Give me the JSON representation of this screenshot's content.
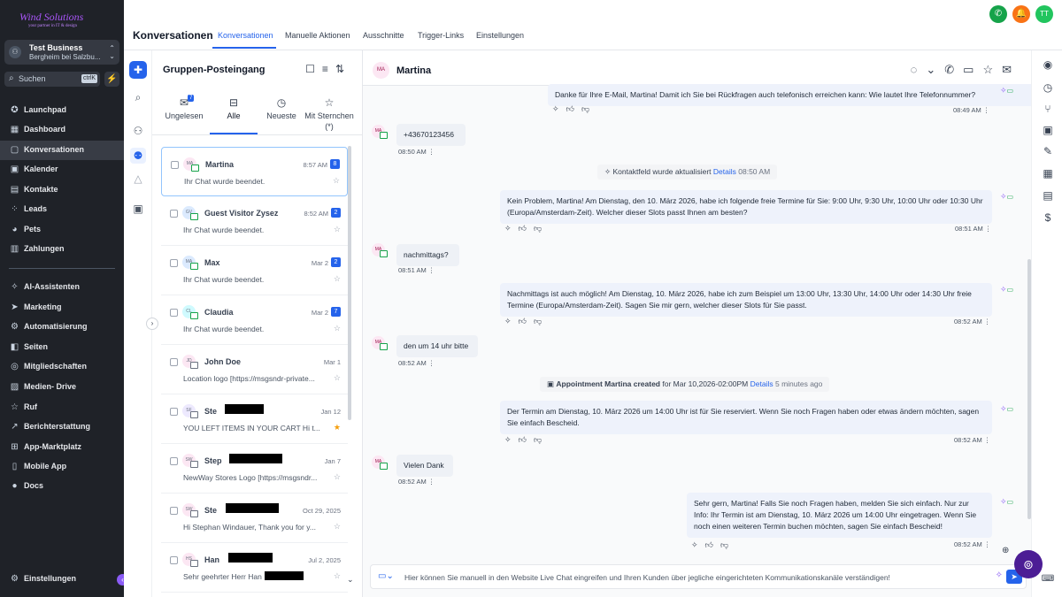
{
  "brand": {
    "logo_text": "Wind Solutions",
    "logo_sub": "your partner in IT & design",
    "color": "#a855f7"
  },
  "account": {
    "initial": "⚇",
    "name": "Test Business",
    "location": "Bergheim bei Salzbu..."
  },
  "search": {
    "placeholder": "Suchen",
    "shortcut": "ctrlK"
  },
  "nav": {
    "items": [
      {
        "label": "Launchpad",
        "icon": "rocket-icon",
        "glyph": "✪"
      },
      {
        "label": "Dashboard",
        "icon": "dashboard-icon",
        "glyph": "▦"
      },
      {
        "label": "Konversationen",
        "icon": "chat-icon",
        "glyph": "▢"
      },
      {
        "label": "Kalender",
        "icon": "calendar-icon",
        "glyph": "▣"
      },
      {
        "label": "Kontakte",
        "icon": "contacts-icon",
        "glyph": "▤"
      },
      {
        "label": "Leads",
        "icon": "leads-icon",
        "glyph": "⁘"
      },
      {
        "label": "Pets",
        "icon": "pets-icon",
        "glyph": "◕"
      },
      {
        "label": "Zahlungen",
        "icon": "payments-icon",
        "glyph": "▥"
      },
      {
        "label": "AI-Assistenten",
        "icon": "ai-icon",
        "glyph": "✧"
      },
      {
        "label": "Marketing",
        "icon": "marketing-icon",
        "glyph": "➤"
      },
      {
        "label": "Automatisierung",
        "icon": "automation-icon",
        "glyph": "⚙"
      },
      {
        "label": "Seiten",
        "icon": "pages-icon",
        "glyph": "◧"
      },
      {
        "label": "Mitgliedschaften",
        "icon": "membership-icon",
        "glyph": "◎"
      },
      {
        "label": "Medien- Drive",
        "icon": "media-icon",
        "glyph": "▨"
      },
      {
        "label": "Ruf",
        "icon": "star-icon",
        "glyph": "☆"
      },
      {
        "label": "Berichterstattung",
        "icon": "reporting-icon",
        "glyph": "↗"
      },
      {
        "label": "App-Marktplatz",
        "icon": "marketplace-icon",
        "glyph": "⊞"
      },
      {
        "label": "Mobile App",
        "icon": "mobile-icon",
        "glyph": "▯"
      },
      {
        "label": "Docs",
        "icon": "docs-icon",
        "glyph": "●"
      }
    ],
    "settings": "Einstellungen"
  },
  "header": {
    "title": "Konversationen",
    "tabs": [
      "Konversationen",
      "Manuelle Aktionen",
      "Ausschnitte",
      "Trigger-Links",
      "Einstellungen"
    ],
    "avatar": "TT"
  },
  "inbox": {
    "title": "Gruppen-Posteingang",
    "filters": [
      {
        "label": "Ungelesen",
        "count": "7"
      },
      {
        "label": "Alle"
      },
      {
        "label": "Neueste"
      },
      {
        "label": "Mit Sternchen (*)"
      }
    ],
    "conversations": [
      {
        "initials": "MA",
        "name": "Martina",
        "time": "8:57 AM",
        "badge": "8",
        "preview": "Ihr Chat wurde beendet.",
        "avatar_color": "#fce7f3",
        "channel": "chat",
        "starred": false
      },
      {
        "initials": "GV",
        "name": "Guest Visitor Zysez",
        "time": "8:52 AM",
        "badge": "2",
        "preview": "Ihr Chat wurde beendet.",
        "avatar_color": "#dbeafe",
        "channel": "chat",
        "starred": false
      },
      {
        "initials": "MA",
        "name": "Max",
        "time": "Mar 2",
        "badge": "2",
        "preview": "Ihr Chat wurde beendet.",
        "avatar_color": "#dbeafe",
        "channel": "chat",
        "starred": false
      },
      {
        "initials": "CL",
        "name": "Claudia",
        "time": "Mar 2",
        "badge": "7",
        "preview": "Ihr Chat wurde beendet.",
        "avatar_color": "#cffafe",
        "channel": "chat",
        "starred": false
      },
      {
        "initials": "JD",
        "name": "John Doe",
        "time": "Mar 1",
        "badge": "",
        "preview": "Location logo [https://msgsndr-private...",
        "avatar_color": "#fce7f3",
        "channel": "mail",
        "starred": false
      },
      {
        "initials": "SF",
        "name": "Ste",
        "time": "Jan 12",
        "badge": "",
        "preview": "YOU LEFT ITEMS IN YOUR CART Hi t...",
        "avatar_color": "#ede9fe",
        "channel": "mail",
        "starred": true
      },
      {
        "initials": "SW",
        "name": "Step",
        "time": "Jan 7",
        "badge": "",
        "preview": "NewWay Stores Logo [https://msgsndr...",
        "avatar_color": "#fce7f3",
        "channel": "mail",
        "starred": false
      },
      {
        "initials": "SW",
        "name": "Ste",
        "time": "Oct 29, 2025",
        "badge": "",
        "preview": "Hi Stephan Windauer, Thank you for y...",
        "avatar_color": "#fce7f3",
        "channel": "mail",
        "starred": false
      },
      {
        "initials": "HS",
        "name": "Han",
        "time": "Jul 2, 2025",
        "badge": "",
        "preview": "Sehr geehrter Herr Han",
        "avatar_color": "#fce7f3",
        "channel": "mail",
        "starred": false
      }
    ]
  },
  "chat": {
    "contact": {
      "initials": "MA",
      "name": "Martina"
    },
    "messages": [
      {
        "kind": "out",
        "text": "Danke für Ihre E-Mail, Martina! Damit ich Sie bei Rückfragen auch telefonisch erreichen kann: Wie lautet Ihre Telefonnummer?",
        "time": "08:49 AM"
      },
      {
        "kind": "in",
        "text": "+43670123456",
        "time": "08:50 AM"
      },
      {
        "kind": "event",
        "text": "Kontaktfeld wurde aktualisiert",
        "link": "Details",
        "time": "08:50 AM"
      },
      {
        "kind": "out",
        "text": "Kein Problem, Martina! Am Dienstag, den 10. März 2026, habe ich folgende freie Termine für Sie: 9:00 Uhr, 9:30 Uhr, 10:00 Uhr oder 10:30 Uhr (Europa/Amsterdam-Zeit). Welcher dieser Slots passt Ihnen am besten?",
        "time": "08:51 AM"
      },
      {
        "kind": "in",
        "text": "nachmittags?",
        "time": "08:51 AM"
      },
      {
        "kind": "out",
        "text": "Nachmittags ist auch möglich! Am Dienstag, 10. März 2026, habe ich zum Beispiel um 13:00 Uhr, 13:30 Uhr, 14:00 Uhr oder 14:30 Uhr freie Termine (Europa/Amsterdam-Zeit). Sagen Sie mir gern, welcher dieser Slots für Sie passt.",
        "time": "08:52 AM"
      },
      {
        "kind": "in",
        "text": "den um 14 uhr bitte",
        "time": "08:52 AM"
      },
      {
        "kind": "event2",
        "bold": "Appointment Martina created",
        "text": " for Mar 10,2026-02:00PM",
        "link": "Details",
        "time": "5 minutes ago"
      },
      {
        "kind": "out",
        "text": "Der Termin am Dienstag, 10. März 2026 um 14:00 Uhr ist für Sie reserviert. Wenn Sie noch Fragen haben oder etwas ändern möchten, sagen Sie einfach Bescheid.",
        "time": "08:52 AM"
      },
      {
        "kind": "in",
        "text": "Vielen Dank",
        "time": "08:52 AM"
      },
      {
        "kind": "out",
        "text": "Sehr gern, Martina! Falls Sie noch Fragen haben, melden Sie sich einfach. Nur zur Info: Ihr Termin ist am Dienstag, 10. März 2026 um 14:00 Uhr eingetragen. Wenn Sie noch einen weiteren Termin buchen möchten, sagen Sie einfach Bescheid!",
        "time": "08:52 AM"
      }
    ],
    "composer_placeholder": "Hier können Sie manuell in den Website Live Chat eingreifen und Ihren Kunden über jegliche eingerichteten Kommunikationskanäle verständigen!"
  },
  "colors": {
    "accent": "#2563eb",
    "sidebar": "#1f2228",
    "ai": "#8b5cf6",
    "phone_button": "#16a34a",
    "notification_button": "#f97316",
    "avatar_button": "#22c55e"
  }
}
